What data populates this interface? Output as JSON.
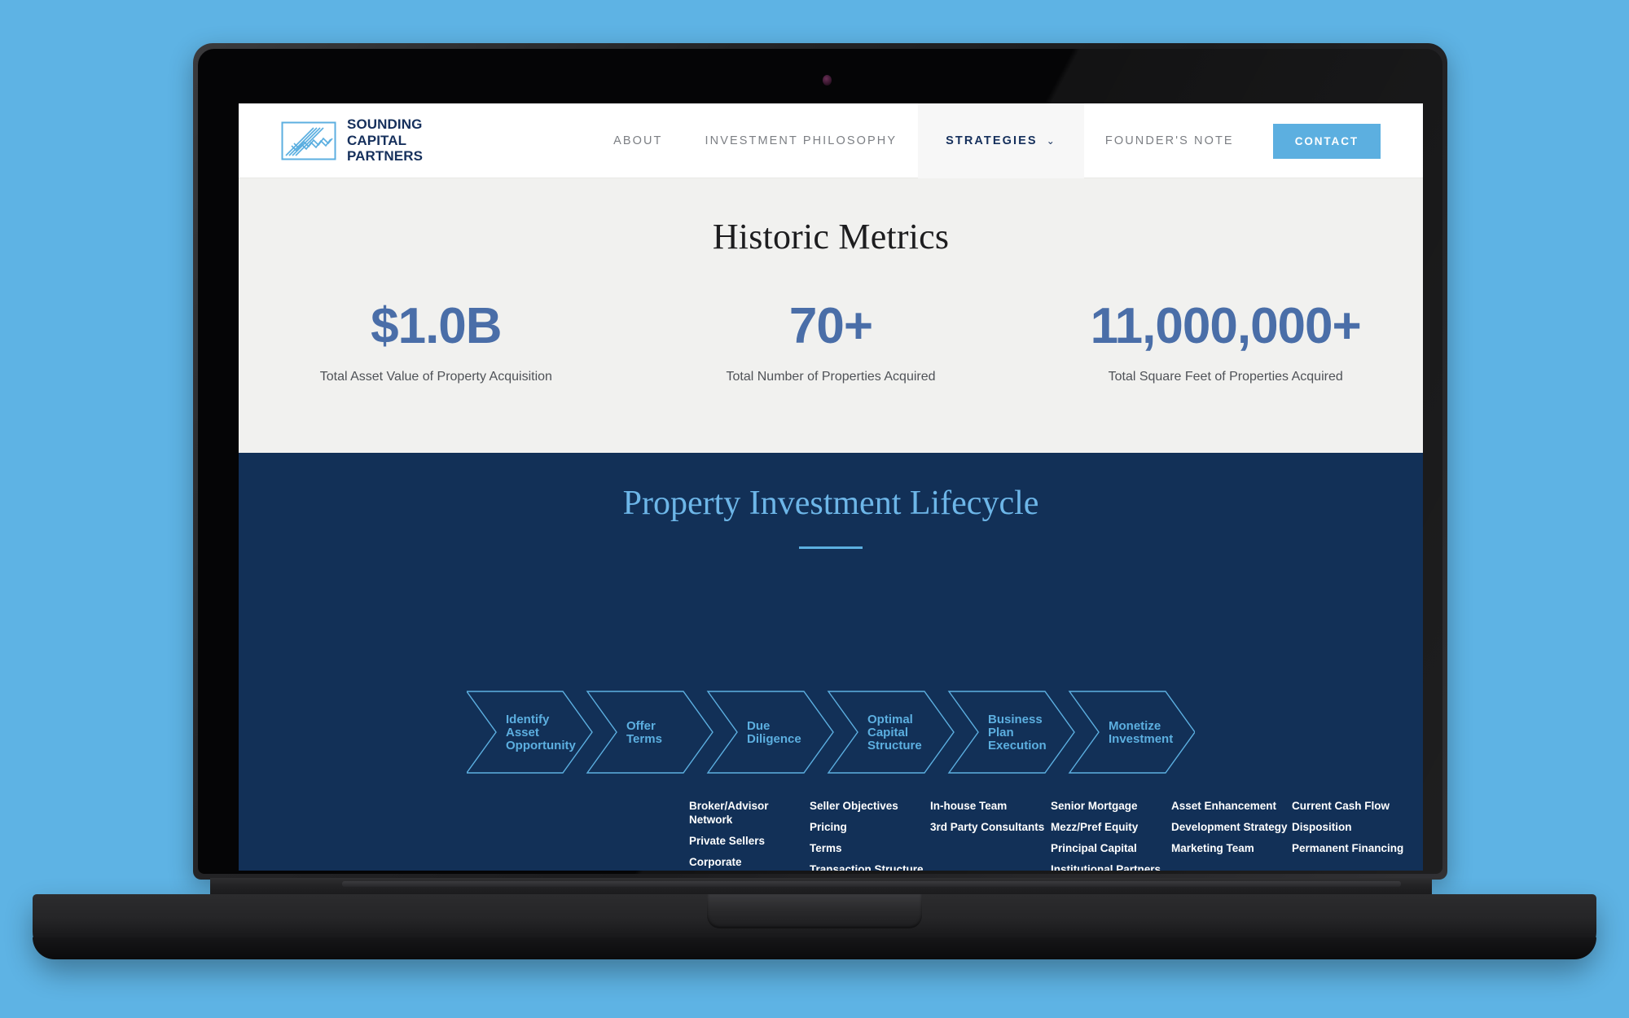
{
  "brand": {
    "wordmark_line1": "SOUNDING",
    "wordmark_line2": "CAPITAL",
    "wordmark_line3": "PARTNERS",
    "logo_icon": "chart-zigzag-logo-icon",
    "navy": "#16305c",
    "light_blue": "#5cafe0"
  },
  "nav": {
    "links": [
      {
        "label": "ABOUT",
        "active": false
      },
      {
        "label": "INVESTMENT PHILOSOPHY",
        "active": false
      },
      {
        "label": "STRATEGIES",
        "active": true,
        "caret": "⌄"
      },
      {
        "label": "FOUNDER'S NOTE",
        "active": false
      }
    ],
    "contact_label": "CONTACT"
  },
  "metrics": {
    "title": "Historic Metrics",
    "items": [
      {
        "value": "$1.0B",
        "label": "Total Asset Value of Property Acquisition"
      },
      {
        "value": "70+",
        "label": "Total Number of Properties Acquired"
      },
      {
        "value": "11,000,000+",
        "label": "Total Square Feet of Properties Acquired"
      }
    ]
  },
  "lifecycle": {
    "title": "Property Investment Lifecycle",
    "stages": [
      {
        "label_lines": [
          "Identify",
          "Asset",
          "Opportunity"
        ],
        "bullets": [
          "Broker/Advisor Network",
          "Private Sellers",
          "Corporate Dispositions"
        ]
      },
      {
        "label_lines": [
          "Offer",
          "Terms"
        ],
        "bullets": [
          "Seller Objectives",
          "Pricing",
          "Terms",
          "Transaction Structure"
        ]
      },
      {
        "label_lines": [
          "Due",
          "Diligence"
        ],
        "bullets": [
          "In-house Team",
          "3rd Party Consultants"
        ]
      },
      {
        "label_lines": [
          "Optimal",
          "Capital",
          "Structure"
        ],
        "bullets": [
          "Senior Mortgage",
          "Mezz/Pref Equity",
          "Principal Capital",
          "Institutional Partners"
        ]
      },
      {
        "label_lines": [
          "Business",
          "Plan",
          "Execution"
        ],
        "bullets": [
          "Asset Enhancement",
          "Development Strategy",
          "Marketing Team"
        ]
      },
      {
        "label_lines": [
          "Monetize",
          "Investment"
        ],
        "bullets": [
          "Current Cash Flow",
          "Disposition",
          "Permanent Financing"
        ]
      }
    ]
  }
}
